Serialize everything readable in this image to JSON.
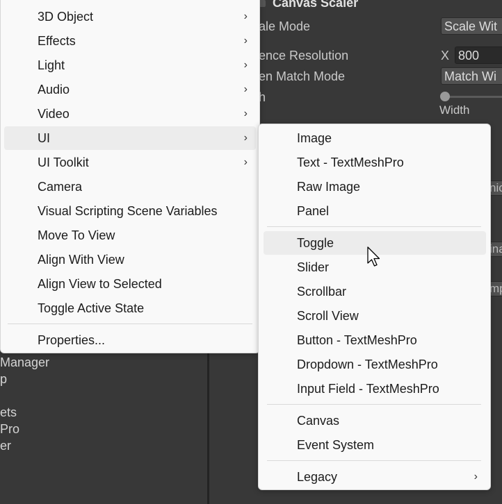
{
  "hierarchy": {
    "items": [
      "Manager",
      "p",
      "ets",
      " Pro",
      "er"
    ]
  },
  "inspector": {
    "component_title": "Canvas Scaler",
    "scale_mode_label": "ale Mode",
    "scale_mode_value": "Scale Wit",
    "reference_resolution_label": "ence Resolution",
    "res_x_label": "X",
    "res_x_value": "800",
    "screen_match_mode_label": "en Match Mode",
    "screen_match_mode_value": "Match Wi",
    "match_label": "h",
    "match_slider_label": "Width",
    "stub_1": "nic",
    "stub_2": "ina",
    "stub_3": "mp"
  },
  "main_menu": {
    "items": [
      {
        "label": "3D Object",
        "submenu": true
      },
      {
        "label": "Effects",
        "submenu": true
      },
      {
        "label": "Light",
        "submenu": true
      },
      {
        "label": "Audio",
        "submenu": true
      },
      {
        "label": "Video",
        "submenu": true
      },
      {
        "label": "UI",
        "submenu": true
      },
      {
        "label": "UI Toolkit",
        "submenu": true
      },
      {
        "label": "Camera",
        "submenu": false
      },
      {
        "label": "Visual Scripting Scene Variables",
        "submenu": false
      },
      {
        "label": "Move To View",
        "submenu": false
      },
      {
        "label": "Align With View",
        "submenu": false
      },
      {
        "label": "Align View to Selected",
        "submenu": false
      },
      {
        "label": "Toggle Active State",
        "submenu": false
      },
      {
        "label": "Properties...",
        "submenu": false
      }
    ],
    "highlighted": "UI"
  },
  "ui_submenu": {
    "items": [
      {
        "label": "Image"
      },
      {
        "label": "Text - TextMeshPro"
      },
      {
        "label": "Raw Image"
      },
      {
        "label": "Panel"
      },
      {
        "label": "Toggle"
      },
      {
        "label": "Slider"
      },
      {
        "label": "Scrollbar"
      },
      {
        "label": "Scroll View"
      },
      {
        "label": "Button - TextMeshPro"
      },
      {
        "label": "Dropdown - TextMeshPro"
      },
      {
        "label": "Input Field - TextMeshPro"
      },
      {
        "label": "Canvas"
      },
      {
        "label": "Event System"
      },
      {
        "label": "Legacy",
        "submenu": true
      }
    ],
    "hovered": "Toggle"
  },
  "icons": {
    "submenu_arrow": "chevron-right-icon",
    "cursor": "mouse-pointer-icon"
  }
}
